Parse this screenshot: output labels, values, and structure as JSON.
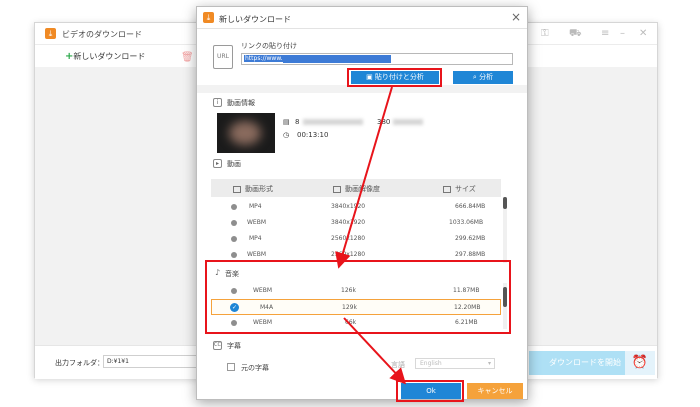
{
  "background_window": {
    "title": "ビデオのダウンロード",
    "new_download_label": "新しいダウンロード",
    "output_folder_label": "出力フォルダ：",
    "output_folder_value": "D:¥1¥1",
    "start_button_label": "ダウンロードを開始"
  },
  "dialog": {
    "title": "新しいダウンロード",
    "link_label": "リンクの貼り付け",
    "url_value": "https://www.",
    "paste_analyze_label": "貼り付けと分析",
    "analyze_label": "分析",
    "video_info_label": "動画情報",
    "video_title_prefix": "8",
    "video_meta_partial": "380",
    "video_duration": "00:13:10",
    "video_section_label": "動画",
    "video_table": {
      "headers": [
        "動画形式",
        "動画解像度",
        "サイズ"
      ],
      "rows": [
        {
          "format": "MP4",
          "resolution": "3840x1920",
          "size": "666.84MB"
        },
        {
          "format": "WEBM",
          "resolution": "3840x1920",
          "size": "1033.06MB"
        },
        {
          "format": "MP4",
          "resolution": "2560x1280",
          "size": "299.62MB"
        },
        {
          "format": "WEBM",
          "resolution": "2560x1280",
          "size": "297.88MB"
        }
      ]
    },
    "audio_section_label": "音楽",
    "audio_rows": [
      {
        "format": "WEBM",
        "bitrate": "126k",
        "size": "11.87MB",
        "selected": false
      },
      {
        "format": "M4A",
        "bitrate": "129k",
        "size": "12.20MB",
        "selected": true
      },
      {
        "format": "WEBM",
        "bitrate": "66k",
        "size": "6.21MB",
        "selected": false
      }
    ],
    "subtitle_section_label": "字幕",
    "original_subtitle_label": "元の字幕",
    "language_label": "言語",
    "language_value": "English",
    "ok_label": "Ok",
    "cancel_label": "キャンセル"
  },
  "colors": {
    "accent_blue": "#1f86d6",
    "cancel_orange": "#f5a23b",
    "annotation_red": "#e8141b",
    "start_button_disabled": "#aee0f5"
  }
}
